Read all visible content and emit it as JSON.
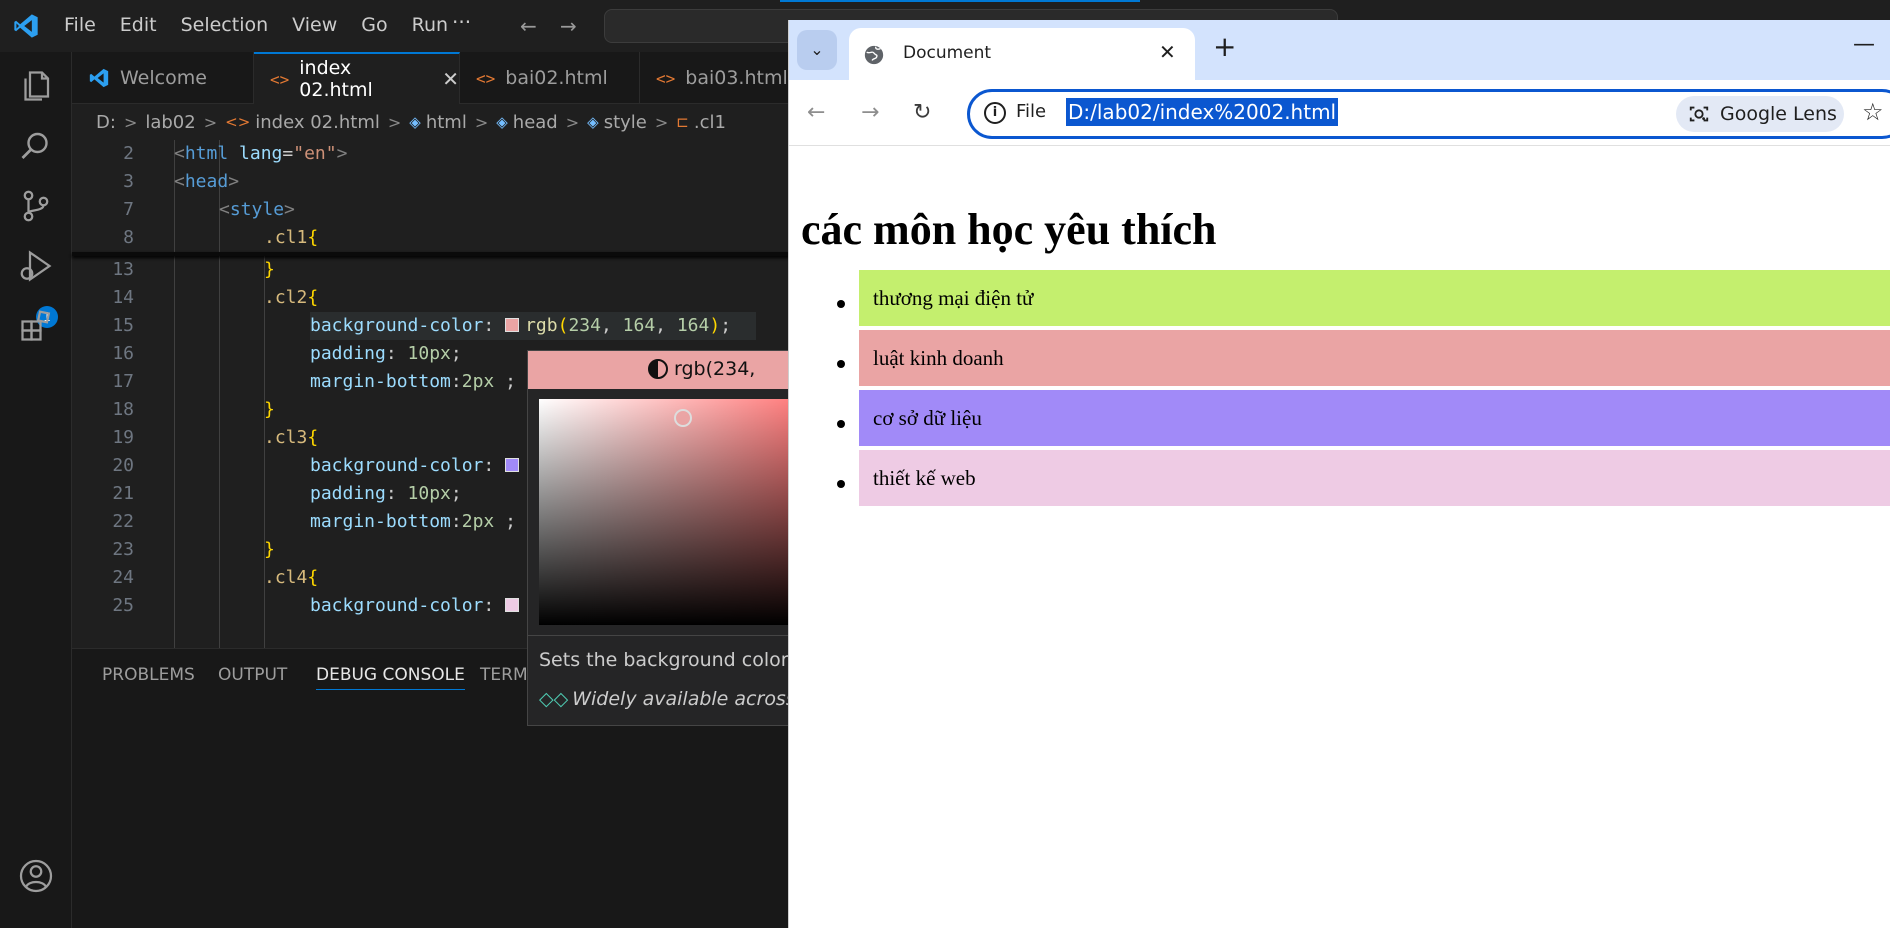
{
  "vscode": {
    "menu": [
      "File",
      "Edit",
      "Selection",
      "View",
      "Go",
      "Run"
    ],
    "more": "···",
    "debug_badge": "1",
    "tabs": [
      {
        "label": "Welcome"
      },
      {
        "label": "index 02.html",
        "close": "✕"
      },
      {
        "label": "bai02.html"
      },
      {
        "label": "bai03.html"
      }
    ],
    "breadcrumbs": [
      "D:",
      "lab02",
      "index 02.html",
      "html",
      "head",
      "style",
      ".cl1"
    ],
    "editor": {
      "lines": [
        {
          "n": "2",
          "code": "<html lang=\"en\">"
        },
        {
          "n": "3",
          "code": "<head>"
        },
        {
          "n": "7",
          "code": "<style>"
        },
        {
          "n": "8",
          "code": ".cl1{"
        },
        {
          "n": "13",
          "code": "}"
        },
        {
          "n": "14",
          "code": ".cl2{"
        },
        {
          "n": "15",
          "code": "background-color: rgb(234, 164, 164);"
        },
        {
          "n": "16",
          "code": "padding: 10px;"
        },
        {
          "n": "17",
          "code": "margin-bottom:2px ;"
        },
        {
          "n": "18",
          "code": "}"
        },
        {
          "n": "19",
          "code": ".cl3{"
        },
        {
          "n": "20",
          "code": "background-color:"
        },
        {
          "n": "21",
          "code": "padding: 10px;"
        },
        {
          "n": "22",
          "code": "margin-bottom:2px ;"
        },
        {
          "n": "23",
          "code": "}"
        },
        {
          "n": "24",
          "code": ".cl4{"
        },
        {
          "n": "25",
          "code": "background-color:"
        }
      ]
    },
    "panel_tabs": [
      "PROBLEMS",
      "OUTPUT",
      "DEBUG CONSOLE",
      "TERMI"
    ],
    "hover": {
      "picker_value": "rgb(234,",
      "description": "Sets the background color",
      "baseline": "Widely available across",
      "swatch_color": "#eaa4a4"
    }
  },
  "chrome": {
    "tab_title": "Document",
    "tab_close": "✕",
    "new_tab": "+",
    "minimize": "—",
    "omnibox_scheme": "File",
    "url": "D:/lab02/index%2002.html",
    "lens_label": "Google Lens",
    "page": {
      "heading": "các môn học yêu thích",
      "items": [
        {
          "text": "thương mại điện tử",
          "color": "#c4ef6e"
        },
        {
          "text": "luật kinh doanh",
          "color": "#eaa4a4"
        },
        {
          "text": "cơ sở dữ liệu",
          "color": "#a18af8"
        },
        {
          "text": "thiết kế web",
          "color": "#eecbe4"
        }
      ]
    }
  }
}
